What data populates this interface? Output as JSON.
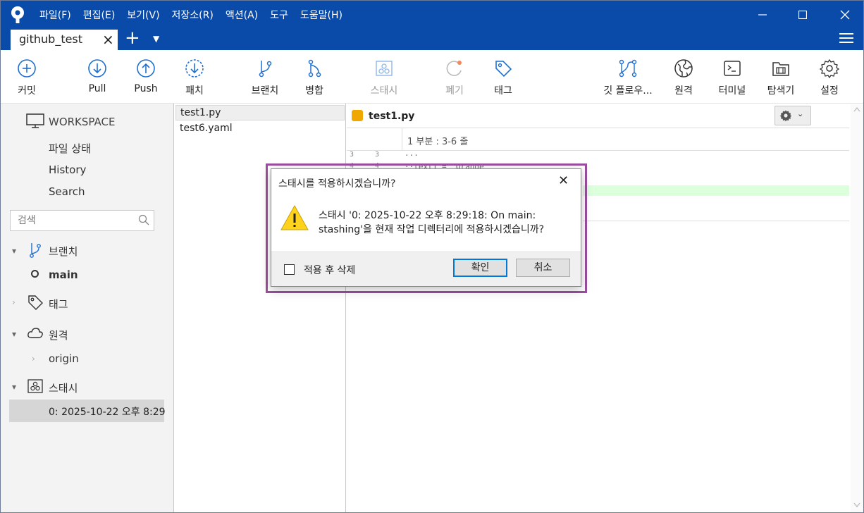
{
  "menu": [
    "파일(F)",
    "편집(E)",
    "보기(V)",
    "저장소(R)",
    "액션(A)",
    "도구",
    "도움말(H)"
  ],
  "tab": {
    "title": "github_test"
  },
  "toolbar": {
    "commit": "커밋",
    "pull": "Pull",
    "push": "Push",
    "patch": "패치",
    "branch": "브랜치",
    "merge": "병합",
    "stash": "스태시",
    "discard": "폐기",
    "tag": "태그",
    "git_flow": "깃 플로우...",
    "remote": "원격",
    "terminal": "터미널",
    "explorer": "탐색기",
    "settings": "설정"
  },
  "sidebar": {
    "workspace": "WORKSPACE",
    "items": [
      "파일 상태",
      "History",
      "Search"
    ],
    "search_placeholder": "검색",
    "branches_label": "브랜치",
    "current_branch": "main",
    "tags_label": "태그",
    "remotes_label": "원격",
    "remote_origin": "origin",
    "stashes_label": "스태시",
    "stash_entry": "0: 2025-10-22 오후 8:29"
  },
  "files": [
    "test1.py",
    "test6.yaml"
  ],
  "diff": {
    "filename": "test1.py",
    "hunk_label": "1 부분 : 3-6 줄",
    "lines": [
      {
        "old": "3",
        "new": "3",
        "code": "···"
      },
      {
        "old": "4",
        "new": "4",
        "code": "··text1 = \"Orange\""
      }
    ]
  },
  "dialog": {
    "title": "스태시를 적용하시겠습니까?",
    "message": "스태시 '0: 2025-10-22 오후 8:29:18: On main: stashing'을 현재 작업 디렉터리에 적용하시겠습니까?",
    "checkbox_label": "적용 후 삭제",
    "confirm": "확인",
    "cancel": "취소"
  },
  "colors": {
    "titlebar": "#0a4aa8",
    "accent": "#1f6fd0",
    "dialog_highlight": "#9b4ea0",
    "diff_added": "#dcffdc"
  }
}
